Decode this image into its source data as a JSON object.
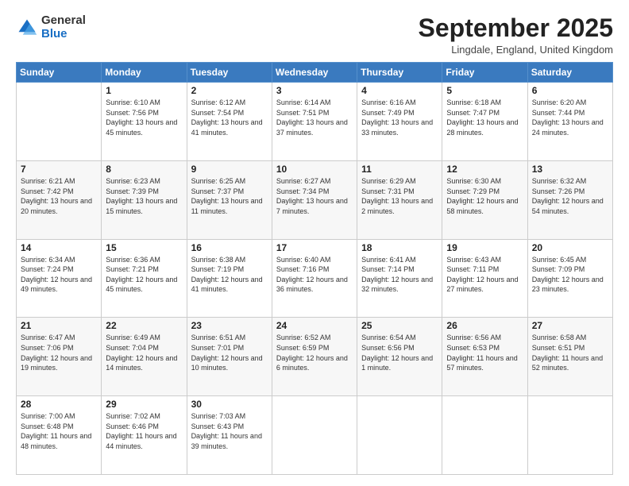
{
  "logo": {
    "general": "General",
    "blue": "Blue"
  },
  "header": {
    "month": "September 2025",
    "location": "Lingdale, England, United Kingdom"
  },
  "weekdays": [
    "Sunday",
    "Monday",
    "Tuesday",
    "Wednesday",
    "Thursday",
    "Friday",
    "Saturday"
  ],
  "weeks": [
    [
      {
        "day": "",
        "sunrise": "",
        "sunset": "",
        "daylight": ""
      },
      {
        "day": "1",
        "sunrise": "Sunrise: 6:10 AM",
        "sunset": "Sunset: 7:56 PM",
        "daylight": "Daylight: 13 hours and 45 minutes."
      },
      {
        "day": "2",
        "sunrise": "Sunrise: 6:12 AM",
        "sunset": "Sunset: 7:54 PM",
        "daylight": "Daylight: 13 hours and 41 minutes."
      },
      {
        "day": "3",
        "sunrise": "Sunrise: 6:14 AM",
        "sunset": "Sunset: 7:51 PM",
        "daylight": "Daylight: 13 hours and 37 minutes."
      },
      {
        "day": "4",
        "sunrise": "Sunrise: 6:16 AM",
        "sunset": "Sunset: 7:49 PM",
        "daylight": "Daylight: 13 hours and 33 minutes."
      },
      {
        "day": "5",
        "sunrise": "Sunrise: 6:18 AM",
        "sunset": "Sunset: 7:47 PM",
        "daylight": "Daylight: 13 hours and 28 minutes."
      },
      {
        "day": "6",
        "sunrise": "Sunrise: 6:20 AM",
        "sunset": "Sunset: 7:44 PM",
        "daylight": "Daylight: 13 hours and 24 minutes."
      }
    ],
    [
      {
        "day": "7",
        "sunrise": "Sunrise: 6:21 AM",
        "sunset": "Sunset: 7:42 PM",
        "daylight": "Daylight: 13 hours and 20 minutes."
      },
      {
        "day": "8",
        "sunrise": "Sunrise: 6:23 AM",
        "sunset": "Sunset: 7:39 PM",
        "daylight": "Daylight: 13 hours and 15 minutes."
      },
      {
        "day": "9",
        "sunrise": "Sunrise: 6:25 AM",
        "sunset": "Sunset: 7:37 PM",
        "daylight": "Daylight: 13 hours and 11 minutes."
      },
      {
        "day": "10",
        "sunrise": "Sunrise: 6:27 AM",
        "sunset": "Sunset: 7:34 PM",
        "daylight": "Daylight: 13 hours and 7 minutes."
      },
      {
        "day": "11",
        "sunrise": "Sunrise: 6:29 AM",
        "sunset": "Sunset: 7:31 PM",
        "daylight": "Daylight: 13 hours and 2 minutes."
      },
      {
        "day": "12",
        "sunrise": "Sunrise: 6:30 AM",
        "sunset": "Sunset: 7:29 PM",
        "daylight": "Daylight: 12 hours and 58 minutes."
      },
      {
        "day": "13",
        "sunrise": "Sunrise: 6:32 AM",
        "sunset": "Sunset: 7:26 PM",
        "daylight": "Daylight: 12 hours and 54 minutes."
      }
    ],
    [
      {
        "day": "14",
        "sunrise": "Sunrise: 6:34 AM",
        "sunset": "Sunset: 7:24 PM",
        "daylight": "Daylight: 12 hours and 49 minutes."
      },
      {
        "day": "15",
        "sunrise": "Sunrise: 6:36 AM",
        "sunset": "Sunset: 7:21 PM",
        "daylight": "Daylight: 12 hours and 45 minutes."
      },
      {
        "day": "16",
        "sunrise": "Sunrise: 6:38 AM",
        "sunset": "Sunset: 7:19 PM",
        "daylight": "Daylight: 12 hours and 41 minutes."
      },
      {
        "day": "17",
        "sunrise": "Sunrise: 6:40 AM",
        "sunset": "Sunset: 7:16 PM",
        "daylight": "Daylight: 12 hours and 36 minutes."
      },
      {
        "day": "18",
        "sunrise": "Sunrise: 6:41 AM",
        "sunset": "Sunset: 7:14 PM",
        "daylight": "Daylight: 12 hours and 32 minutes."
      },
      {
        "day": "19",
        "sunrise": "Sunrise: 6:43 AM",
        "sunset": "Sunset: 7:11 PM",
        "daylight": "Daylight: 12 hours and 27 minutes."
      },
      {
        "day": "20",
        "sunrise": "Sunrise: 6:45 AM",
        "sunset": "Sunset: 7:09 PM",
        "daylight": "Daylight: 12 hours and 23 minutes."
      }
    ],
    [
      {
        "day": "21",
        "sunrise": "Sunrise: 6:47 AM",
        "sunset": "Sunset: 7:06 PM",
        "daylight": "Daylight: 12 hours and 19 minutes."
      },
      {
        "day": "22",
        "sunrise": "Sunrise: 6:49 AM",
        "sunset": "Sunset: 7:04 PM",
        "daylight": "Daylight: 12 hours and 14 minutes."
      },
      {
        "day": "23",
        "sunrise": "Sunrise: 6:51 AM",
        "sunset": "Sunset: 7:01 PM",
        "daylight": "Daylight: 12 hours and 10 minutes."
      },
      {
        "day": "24",
        "sunrise": "Sunrise: 6:52 AM",
        "sunset": "Sunset: 6:59 PM",
        "daylight": "Daylight: 12 hours and 6 minutes."
      },
      {
        "day": "25",
        "sunrise": "Sunrise: 6:54 AM",
        "sunset": "Sunset: 6:56 PM",
        "daylight": "Daylight: 12 hours and 1 minute."
      },
      {
        "day": "26",
        "sunrise": "Sunrise: 6:56 AM",
        "sunset": "Sunset: 6:53 PM",
        "daylight": "Daylight: 11 hours and 57 minutes."
      },
      {
        "day": "27",
        "sunrise": "Sunrise: 6:58 AM",
        "sunset": "Sunset: 6:51 PM",
        "daylight": "Daylight: 11 hours and 52 minutes."
      }
    ],
    [
      {
        "day": "28",
        "sunrise": "Sunrise: 7:00 AM",
        "sunset": "Sunset: 6:48 PM",
        "daylight": "Daylight: 11 hours and 48 minutes."
      },
      {
        "day": "29",
        "sunrise": "Sunrise: 7:02 AM",
        "sunset": "Sunset: 6:46 PM",
        "daylight": "Daylight: 11 hours and 44 minutes."
      },
      {
        "day": "30",
        "sunrise": "Sunrise: 7:03 AM",
        "sunset": "Sunset: 6:43 PM",
        "daylight": "Daylight: 11 hours and 39 minutes."
      },
      {
        "day": "",
        "sunrise": "",
        "sunset": "",
        "daylight": ""
      },
      {
        "day": "",
        "sunrise": "",
        "sunset": "",
        "daylight": ""
      },
      {
        "day": "",
        "sunrise": "",
        "sunset": "",
        "daylight": ""
      },
      {
        "day": "",
        "sunrise": "",
        "sunset": "",
        "daylight": ""
      }
    ]
  ]
}
